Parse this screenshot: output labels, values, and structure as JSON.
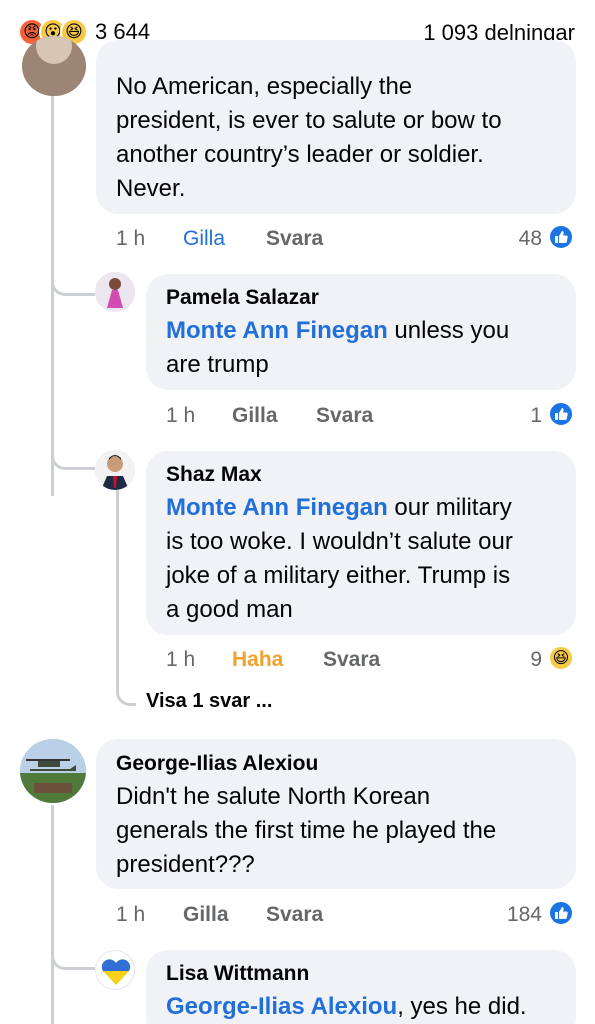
{
  "header": {
    "reaction_icons": [
      "angry-emoji",
      "wow-emoji",
      "haha-emoji"
    ],
    "reaction_count": "3 644",
    "shares": "1 093 delningar"
  },
  "comments": [
    {
      "text": "No American, especially the president, is ever to salute or bow to another country’s leader or soldier. Never.",
      "lines": [
        "No American, especially the",
        "president, is ever to salute or bow to",
        "another country’s leader or soldier.",
        "Never."
      ],
      "time": "1 h",
      "like_label": "Gilla",
      "reply_label": "Svara",
      "reaction_count": "48"
    },
    {
      "name": "Pamela Salazar",
      "mention": "Monte Ann Finegan",
      "line1_rest": " unless you",
      "lines_after": [
        "are trump"
      ],
      "time": "1 h",
      "like_label": "Gilla",
      "reply_label": "Svara",
      "reaction_count": "1"
    },
    {
      "name": "Shaz Max",
      "mention": "Monte Ann Finegan",
      "line1_rest": " our military",
      "lines_after": [
        "is too woke. I wouldn’t salute our",
        "joke of a military either. Trump is",
        "a good man"
      ],
      "time": "1 h",
      "like_label": "Haha",
      "reply_label": "Svara",
      "reaction_count": "9"
    },
    {
      "name": "George-Ilias Alexiou",
      "lines": [
        "Didn't he salute North Korean",
        "generals the first time he played the",
        "president???"
      ],
      "time": "1 h",
      "like_label": "Gilla",
      "reply_label": "Svara",
      "reaction_count": "184"
    },
    {
      "name": "Lisa Wittmann",
      "mention": "George-Ilias Alexiou",
      "line1_rest": ", yes he did."
    }
  ],
  "view_more": "Visa 1 svar ...",
  "colors": {
    "link": "#216fdb",
    "muted": "#65676b",
    "bubble": "#f0f2f5",
    "like_blue": "#1b74e4",
    "haha_yellow": "#f7c948",
    "haha_text": "#f1a22b"
  }
}
